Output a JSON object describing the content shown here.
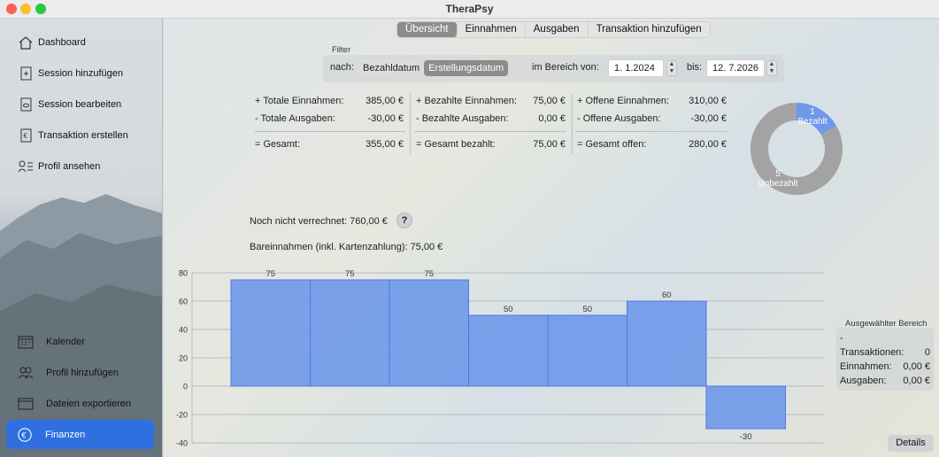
{
  "window": {
    "title": "TheraPsy"
  },
  "sidebar": {
    "items": [
      {
        "label": "Dashboard",
        "icon": "house-icon"
      },
      {
        "label": "Session hinzufügen",
        "icon": "document-add-icon"
      },
      {
        "label": "Session bearbeiten",
        "icon": "document-edit-icon"
      },
      {
        "label": "Transaktion erstellen",
        "icon": "euro-document-icon"
      },
      {
        "label": "Profil ansehen",
        "icon": "person-list-icon"
      }
    ],
    "lower_items": [
      {
        "label": "Kalender",
        "icon": "calendar-icon"
      },
      {
        "label": "Profil hinzufügen",
        "icon": "people-icon"
      },
      {
        "label": "Dateien exportieren",
        "icon": "window-icon"
      }
    ],
    "active_item": {
      "label": "Finanzen",
      "icon": "euro-circle-icon"
    }
  },
  "tabs": [
    "Übersicht",
    "Einnahmen",
    "Ausgaben",
    "Transaktion hinzufügen"
  ],
  "filter": {
    "label": "Filter",
    "nach_label": "nach:",
    "options": [
      "Bezahldatum",
      "Erstellungsdatum"
    ],
    "selected": "Erstellungsdatum",
    "range_label": "im Bereich von:",
    "from_date": "1.  1.2024",
    "to_label": "bis:",
    "to_date": "12.  7.2026"
  },
  "summary": {
    "total": [
      {
        "label": "+ Totale Einnahmen:",
        "value": "385,00 €"
      },
      {
        "label": "- Totale Ausgaben:",
        "value": "-30,00 €"
      },
      {
        "label": "= Gesamt:",
        "value": "355,00 €"
      }
    ],
    "paid": [
      {
        "label": "+ Bezahlte Einnahmen:",
        "value": "75,00 €"
      },
      {
        "label": "- Bezahlte Ausgaben:",
        "value": "0,00 €"
      },
      {
        "label": "= Gesamt bezahlt:",
        "value": "75,00 €"
      }
    ],
    "open": [
      {
        "label": "+ Offene Einnahmen:",
        "value": "310,00 €"
      },
      {
        "label": "- Offene Ausgaben:",
        "value": "-30,00 €"
      },
      {
        "label": "= Gesamt offen:",
        "value": "280,00 €"
      }
    ]
  },
  "donut": {
    "segments": [
      {
        "count": "1",
        "label": "Bezahlt",
        "value": 1,
        "color": "#6f98ea"
      },
      {
        "count": "5",
        "label": "Unbezahlt",
        "value": 5,
        "color": "#a3a3a3"
      }
    ]
  },
  "notes": {
    "not_billed": "Noch nicht verrechnet: 760,00 €",
    "help": "?",
    "cash": "Bareinnahmen (inkl. Kartenzahlung): 75,00 €"
  },
  "chart_data": {
    "type": "bar",
    "values": [
      75,
      75,
      75,
      50,
      50,
      60,
      -30
    ],
    "value_labels": [
      "75",
      "75",
      "75",
      "50",
      "50",
      "60",
      "-30"
    ],
    "y_ticks": [
      "80",
      "60",
      "40",
      "20",
      "0",
      "-20",
      "-40"
    ],
    "ylim": [
      -40,
      80
    ],
    "grid": true,
    "bar_color": "#6f98ea"
  },
  "selection": {
    "title": "Ausgewählter Bereich",
    "range": "-",
    "transactions_label": "Transaktionen:",
    "transactions_value": "0",
    "income_label": "Einnahmen:",
    "income_value": "0,00 €",
    "expense_label": "Ausgaben:",
    "expense_value": "0,00 €"
  },
  "details_button": "Details"
}
